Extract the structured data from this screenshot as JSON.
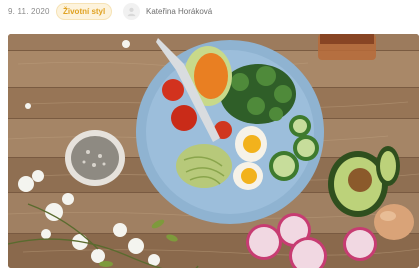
{
  "article": {
    "date": "9. 11. 2020",
    "category_tag": "Životní styl",
    "author_avatar_icon": "user-avatar-icon",
    "author_name": "Kateřina Horáková"
  },
  "hero_image": {
    "subject": "healthy-food-bowl-photo"
  },
  "colors": {
    "tag_text": "#e0a222",
    "tag_background": "#fdf3dc",
    "meta_text": "#8a8a8a"
  }
}
